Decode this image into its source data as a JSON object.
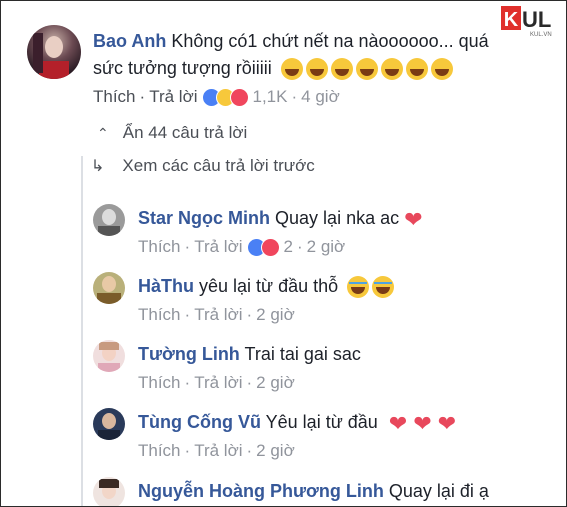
{
  "watermark": {
    "brand": "KUL",
    "sub": "KUL.VN",
    "icons": [
      "logo-k-icon"
    ]
  },
  "main_comment": {
    "author": "Bao Anh",
    "text_line1": "Không có1 chứt nết na nàoooooo... quá",
    "text_line2": "sức tưởng tượng rồiiiii",
    "emoji_count": 7,
    "like_label": "Thích",
    "reply_label": "Trả lời",
    "reaction_count": "1,1K",
    "time": "4 giờ",
    "hide_replies": "Ẩn 44 câu trả lời",
    "view_previous": "Xem các câu trả lời trước"
  },
  "replies": [
    {
      "author": "Star Ngọc Minh",
      "text": "Quay lại nka ac",
      "tail": "heart",
      "like_label": "Thích",
      "reply_label": "Trả lời",
      "reaction_count": "2",
      "time": "2 giờ"
    },
    {
      "author": "HàThu",
      "text": "yêu lại từ đầu thỗ",
      "tail": "cry2",
      "like_label": "Thích",
      "reply_label": "Trả lời",
      "reaction_count": "",
      "time": "2 giờ"
    },
    {
      "author": "Tường Linh",
      "text": "Trai tai gai sac",
      "tail": "",
      "like_label": "Thích",
      "reply_label": "Trả lời",
      "reaction_count": "",
      "time": "2 giờ"
    },
    {
      "author": "Tùng Cống Vũ",
      "text": "Yêu lại từ đầu",
      "tail": "hearts3",
      "like_label": "Thích",
      "reply_label": "Trả lời",
      "reaction_count": "",
      "time": "2 giờ"
    },
    {
      "author": "Nguyễn Hoàng Phương Linh",
      "text": "Quay lại đi ạ",
      "tail": "",
      "like_label": "",
      "reply_label": "",
      "reaction_count": "",
      "time": ""
    }
  ],
  "colors": {
    "name": "#365899",
    "meta": "#90949c",
    "like": "#4a80f5",
    "love": "#f0465d",
    "haha": "#f7c83b"
  }
}
